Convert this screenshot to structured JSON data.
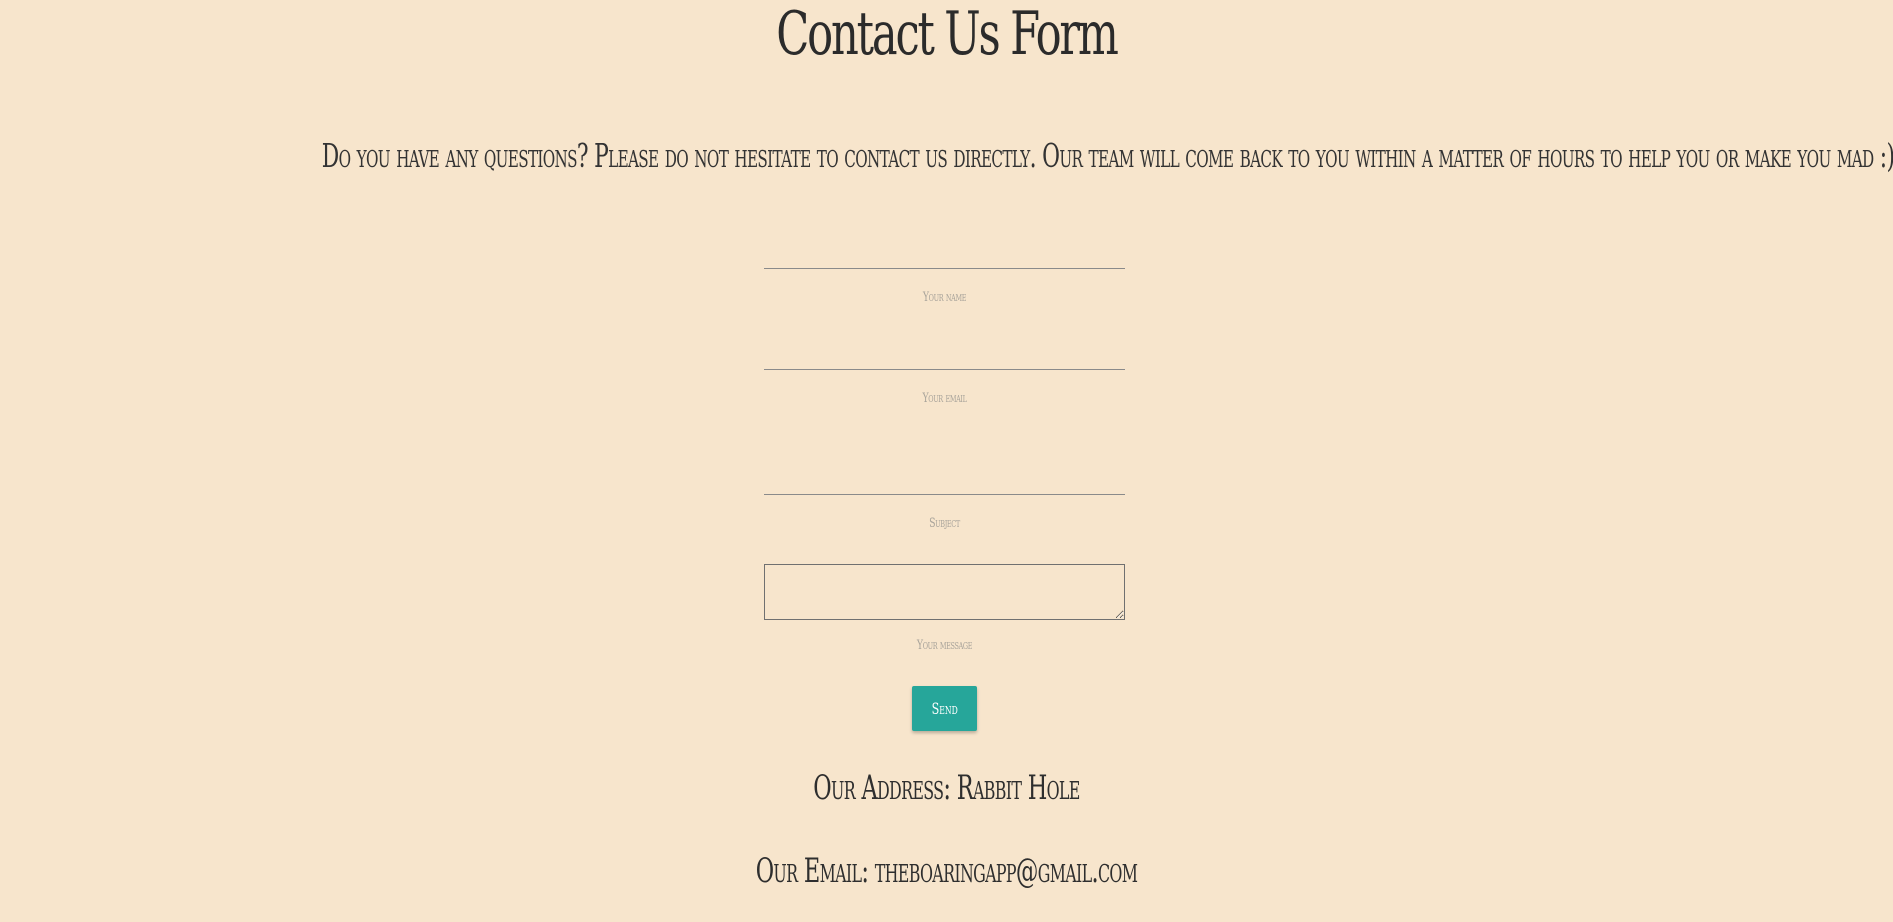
{
  "page": {
    "title": "Contact Us Form",
    "intro": "Do you have any questions? Please do not hesitate to contact us directly. Our team will come back to you within a matter of hours to help you or make you mad :)"
  },
  "form": {
    "name": {
      "value": "",
      "label": "Your name"
    },
    "email": {
      "value": "",
      "label": "Your email"
    },
    "subject": {
      "value": "",
      "label": "Subject"
    },
    "message": {
      "value": "",
      "label": "Your message"
    },
    "send_label": "Send"
  },
  "footer": {
    "address": "Our Address: Rabbit Hole",
    "email": "Our Email: theboaringapp@gmail.com"
  },
  "colors": {
    "background": "#f7e5cc",
    "accent": "#26a69a"
  }
}
